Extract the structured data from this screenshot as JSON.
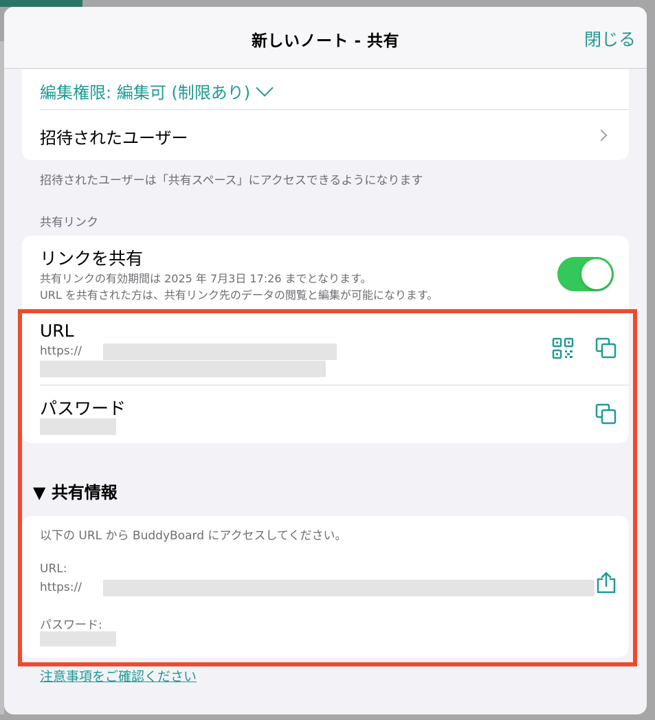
{
  "dialog": {
    "title": "新しいノート - 共有",
    "close_label": "閉じる"
  },
  "permission": {
    "label": "編集権限: 編集可 (制限あり)"
  },
  "invited": {
    "label": "招待されたユーザー",
    "note": "招待されたユーザーは「共有スペース」にアクセスできるようになります"
  },
  "share_link": {
    "section_label": "共有リンク",
    "toggle_label": "リンクを共有",
    "enabled": true,
    "desc_line1": "共有リンクの有効期間は 2025 年 7月3日 17:26 までとなります。",
    "desc_line2": "URL を共有された方は、共有リンク先のデータの閲覧と編集が可能になります。",
    "url_label": "URL",
    "url_prefix": "https://",
    "password_label": "パスワード"
  },
  "share_info": {
    "header": "▼ 共有情報",
    "intro": "以下の URL から BuddyBoard にアクセスしてください。",
    "url_label": "URL:",
    "url_prefix": "https://",
    "password_label": "パスワード:"
  },
  "footer": {
    "notice_link": "注意事項をご確認ください"
  },
  "colors": {
    "accent": "#1f9a92",
    "toggle_on": "#34c759",
    "highlight": "#ef4a2e"
  },
  "icons": [
    "chevron-down-icon",
    "chevron-right-icon",
    "qr-code-icon",
    "copy-icon",
    "share-icon"
  ]
}
